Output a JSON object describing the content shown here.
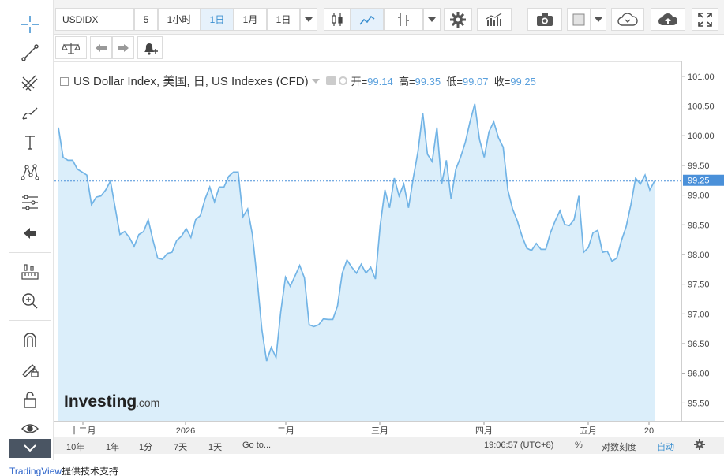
{
  "toolbar": {
    "symbol": "USDIDX",
    "interval_5": "5",
    "interval_1h": "1小时",
    "interval_1d": "1日",
    "interval_1m": "1月",
    "interval_current": "1日"
  },
  "legend": {
    "title": "US Dollar Index, 美国, 日, US Indexes (CFD)",
    "open_label": "开=",
    "open": "99.14",
    "high_label": "高=",
    "high": "99.35",
    "low_label": "低=",
    "low": "99.07",
    "close_label": "收=",
    "close": "99.25"
  },
  "price_axis": {
    "ticks": [
      "101.00",
      "100.50",
      "100.00",
      "99.50",
      "99.00",
      "98.50",
      "98.00",
      "97.50",
      "97.00",
      "96.50",
      "96.00",
      "95.50"
    ],
    "current": "99.25"
  },
  "time_axis": {
    "labels": [
      "十二月",
      "2026",
      "二月",
      "三月",
      "四月",
      "五月",
      "20"
    ]
  },
  "bottom_bar": {
    "ranges": [
      "10年",
      "1年",
      "1分",
      "7天",
      "1天"
    ],
    "goto": "Go to...",
    "time": "19:06:57 (UTC+8)",
    "percent": "%",
    "log_scale": "对数刻度",
    "auto": "自动"
  },
  "watermark": {
    "brand": "Investing",
    "suffix": ".com"
  },
  "footer": {
    "link": "TradingView",
    "suffix": "提供技术支持"
  },
  "colors": {
    "line": "#72b4e6",
    "area": "#dbeefa",
    "accent": "#3a8fd0",
    "current_price_bg": "#4a90d9"
  },
  "chart_data": {
    "type": "area",
    "title": "US Dollar Index, 美国, 日, US Indexes (CFD)",
    "ylim": [
      95.2,
      101.25
    ],
    "series": [
      {
        "name": "US Dollar Index",
        "values": [
          100.15,
          99.65,
          99.6,
          99.6,
          99.45,
          99.4,
          99.35,
          98.85,
          98.98,
          99.0,
          99.1,
          99.25,
          98.8,
          98.35,
          98.4,
          98.3,
          98.15,
          98.35,
          98.4,
          98.6,
          98.25,
          97.95,
          97.93,
          98.03,
          98.05,
          98.25,
          98.32,
          98.45,
          98.3,
          98.6,
          98.67,
          98.95,
          99.15,
          98.9,
          99.15,
          99.15,
          99.33,
          99.4,
          99.4,
          98.65,
          98.78,
          98.35,
          97.6,
          96.75,
          96.22,
          96.45,
          96.28,
          97.05,
          97.63,
          97.48,
          97.65,
          97.83,
          97.62,
          96.83,
          96.8,
          96.83,
          96.93,
          96.92,
          96.92,
          97.15,
          97.7,
          97.92,
          97.8,
          97.7,
          97.85,
          97.7,
          97.8,
          97.6,
          98.5,
          99.1,
          98.8,
          99.3,
          99.0,
          99.2,
          98.8,
          99.3,
          99.75,
          100.4,
          99.7,
          99.58,
          100.15,
          99.2,
          99.6,
          98.95,
          99.45,
          99.65,
          99.9,
          100.25,
          100.55,
          99.95,
          99.65,
          100.08,
          100.25,
          99.98,
          99.82,
          99.1,
          98.78,
          98.58,
          98.32,
          98.12,
          98.08,
          98.2,
          98.1,
          98.1,
          98.38,
          98.58,
          98.75,
          98.52,
          98.5,
          98.6,
          99.0,
          98.05,
          98.13,
          98.38,
          98.42,
          98.05,
          98.07,
          97.9,
          97.95,
          98.25,
          98.48,
          98.85,
          99.3,
          99.2,
          99.35,
          99.1,
          99.25
        ]
      }
    ],
    "x_labels": [
      "十二月",
      "2026",
      "二月",
      "三月",
      "四月",
      "五月",
      "20"
    ],
    "last_value": 99.25,
    "legend": "top-left"
  }
}
